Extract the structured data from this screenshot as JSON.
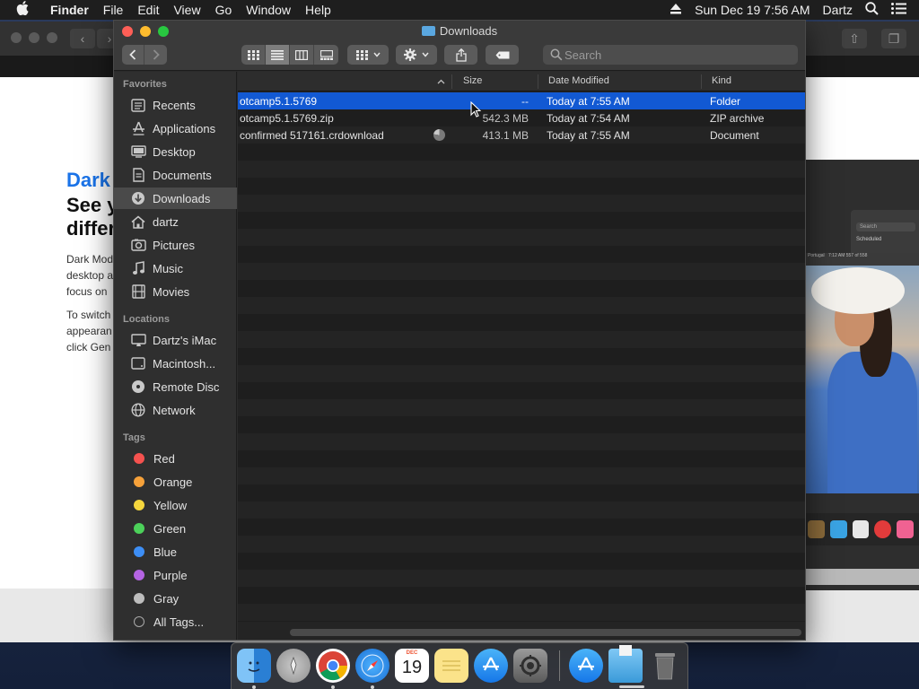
{
  "menubar": {
    "app_name": "Finder",
    "menus": [
      "File",
      "Edit",
      "View",
      "Go",
      "Window",
      "Help"
    ],
    "clock": "Sun Dec 19  7:56 AM",
    "user": "Dartz"
  },
  "browser": {
    "kicker": "Dark",
    "headline": [
      "See y",
      "differ"
    ],
    "paragraph1": [
      "Dark Mod",
      "desktop a",
      "focus on"
    ],
    "paragraph2": [
      "To switch",
      "appearan",
      "click Gen"
    ],
    "promo": {
      "search": "Search",
      "scheduled": "Scheduled",
      "bar_text": "Portugal",
      "bar_sub": "7:12 AM   557 of 558"
    }
  },
  "finder": {
    "title": "Downloads",
    "search_placeholder": "Search",
    "sidebar": {
      "favorites_label": "Favorites",
      "favorites": [
        {
          "label": "Recents",
          "icon": "recents-icon"
        },
        {
          "label": "Applications",
          "icon": "applications-icon"
        },
        {
          "label": "Desktop",
          "icon": "desktop-icon"
        },
        {
          "label": "Documents",
          "icon": "documents-icon"
        },
        {
          "label": "Downloads",
          "icon": "downloads-icon",
          "selected": true
        },
        {
          "label": "dartz",
          "icon": "home-icon"
        },
        {
          "label": "Pictures",
          "icon": "pictures-icon"
        },
        {
          "label": "Music",
          "icon": "music-icon"
        },
        {
          "label": "Movies",
          "icon": "movies-icon"
        }
      ],
      "locations_label": "Locations",
      "locations": [
        {
          "label": "Dartz's iMac",
          "icon": "imac-icon"
        },
        {
          "label": "Macintosh...",
          "icon": "disk-icon"
        },
        {
          "label": "Remote Disc",
          "icon": "remote-disc-icon"
        },
        {
          "label": "Network",
          "icon": "network-icon"
        }
      ],
      "tags_label": "Tags",
      "tags": [
        {
          "label": "Red",
          "color": "#f5524f"
        },
        {
          "label": "Orange",
          "color": "#f6a13a"
        },
        {
          "label": "Yellow",
          "color": "#f5d63d"
        },
        {
          "label": "Green",
          "color": "#4cd15a"
        },
        {
          "label": "Blue",
          "color": "#3d8ef5"
        },
        {
          "label": "Purple",
          "color": "#b564e3"
        },
        {
          "label": "Gray",
          "color": "#bdbdbd"
        },
        {
          "label": "All Tags...",
          "color": ""
        }
      ]
    },
    "columns": {
      "size": "Size",
      "date_modified": "Date Modified",
      "kind": "Kind"
    },
    "files": [
      {
        "name": "otcamp5.1.5769",
        "size": "--",
        "date": "Today at 7:55 AM",
        "kind": "Folder",
        "selected": true
      },
      {
        "name": "otcamp5.1.5769.zip",
        "size": "542.3 MB",
        "date": "Today at 7:54 AM",
        "kind": "ZIP archive"
      },
      {
        "name": "confirmed 517161.crdownload",
        "size": "413.1 MB",
        "date": "Today at 7:55 AM",
        "kind": "Document",
        "in_progress": true
      }
    ]
  },
  "dock": {
    "calendar_month": "DEC",
    "calendar_day": "19"
  }
}
